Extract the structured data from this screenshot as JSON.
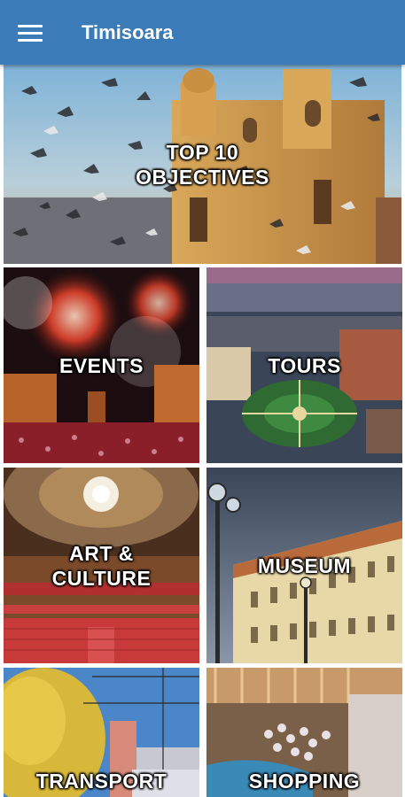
{
  "appbar": {
    "title": "Timisoara",
    "menu_icon": "hamburger-menu-icon",
    "color": "#3a7bb8"
  },
  "tiles": [
    {
      "label": "TOP 10\nOBJECTIVES",
      "image": "cathedral-with-pigeons"
    },
    {
      "label": "EVENTS",
      "image": "fireworks-over-square"
    },
    {
      "label": "TOURS",
      "image": "aerial-city-square-night"
    },
    {
      "label": "ART &\nCULTURE",
      "image": "opera-hall-interior"
    },
    {
      "label": "MUSEUM",
      "image": "baroque-palace-street-lamp"
    },
    {
      "label": "TRANSPORT",
      "image": "tram-lines-autumn-tree"
    },
    {
      "label": "SHOPPING",
      "image": "mall-interior-chandelier"
    }
  ]
}
